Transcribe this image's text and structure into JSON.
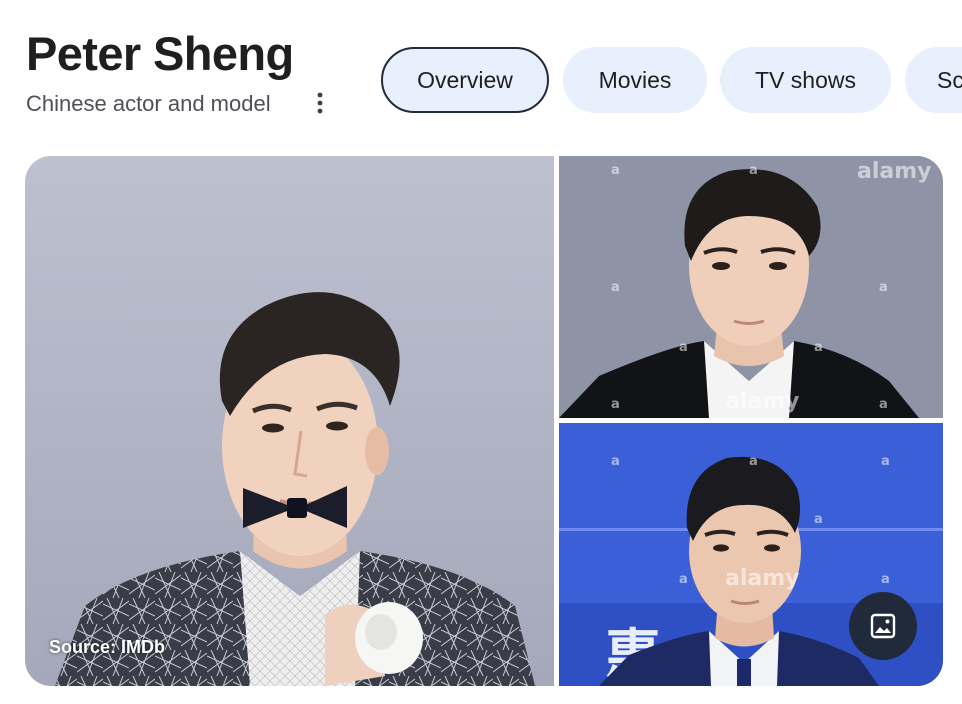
{
  "header": {
    "title": "Peter Sheng",
    "subtitle": "Chinese actor and model"
  },
  "tabs": [
    {
      "label": "Overview",
      "active": true
    },
    {
      "label": "Movies",
      "active": false
    },
    {
      "label": "TV shows",
      "active": false
    },
    {
      "label": "Sc",
      "active": false
    }
  ],
  "gallery": {
    "main_image_source": "Source: IMDb",
    "watermark": "alamy",
    "watermark_letter": "a",
    "backdrop_text": "惠",
    "images_button_icon": "image-icon"
  },
  "colors": {
    "chip_bg": "#e8f0fe",
    "chip_active_border": "#1f2d3a",
    "title": "#1f1f1f",
    "subtitle": "#4d5156"
  }
}
